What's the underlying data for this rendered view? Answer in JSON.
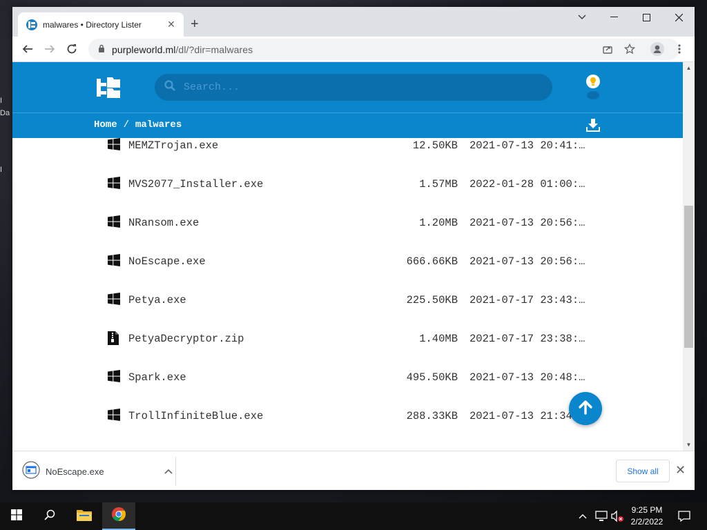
{
  "browser": {
    "tab_title": "malwares • Directory Lister",
    "url_host": "purpleworld.ml",
    "url_path": "/dl/?dir=malwares"
  },
  "site": {
    "search_placeholder": "Search...",
    "breadcrumb": {
      "home": "Home",
      "separator": "/",
      "current": "malwares"
    },
    "accent_color": "#0a87cc"
  },
  "files": [
    {
      "icon": "windows-icon",
      "name": "MEMZTrojan.exe",
      "size": "12.50KB",
      "date": "2021-07-13 20:41:…"
    },
    {
      "icon": "windows-icon",
      "name": "MVS2077_Installer.exe",
      "size": "1.57MB",
      "date": "2022-01-28 01:00:…"
    },
    {
      "icon": "windows-icon",
      "name": "NRansom.exe",
      "size": "1.20MB",
      "date": "2021-07-13 20:56:…"
    },
    {
      "icon": "windows-icon",
      "name": "NoEscape.exe",
      "size": "666.66KB",
      "date": "2021-07-13 20:56:…"
    },
    {
      "icon": "windows-icon",
      "name": "Petya.exe",
      "size": "225.50KB",
      "date": "2021-07-17 23:43:…"
    },
    {
      "icon": "zip-file-icon",
      "name": "PetyaDecryptor.zip",
      "size": "1.40MB",
      "date": "2021-07-17 23:38:…"
    },
    {
      "icon": "windows-icon",
      "name": "Spark.exe",
      "size": "495.50KB",
      "date": "2021-07-13 20:48:…"
    },
    {
      "icon": "windows-icon",
      "name": "TrollInfiniteBlue.exe",
      "size": "288.33KB",
      "date": "2021-07-13 21:34:…"
    }
  ],
  "download_shelf": {
    "file_name": "NoEscape.exe",
    "show_all_label": "Show all"
  },
  "taskbar": {
    "time": "9:25 PM",
    "date": "2/2/2022"
  },
  "desktop": {
    "fragments": [
      "I",
      "Da",
      "I"
    ]
  }
}
